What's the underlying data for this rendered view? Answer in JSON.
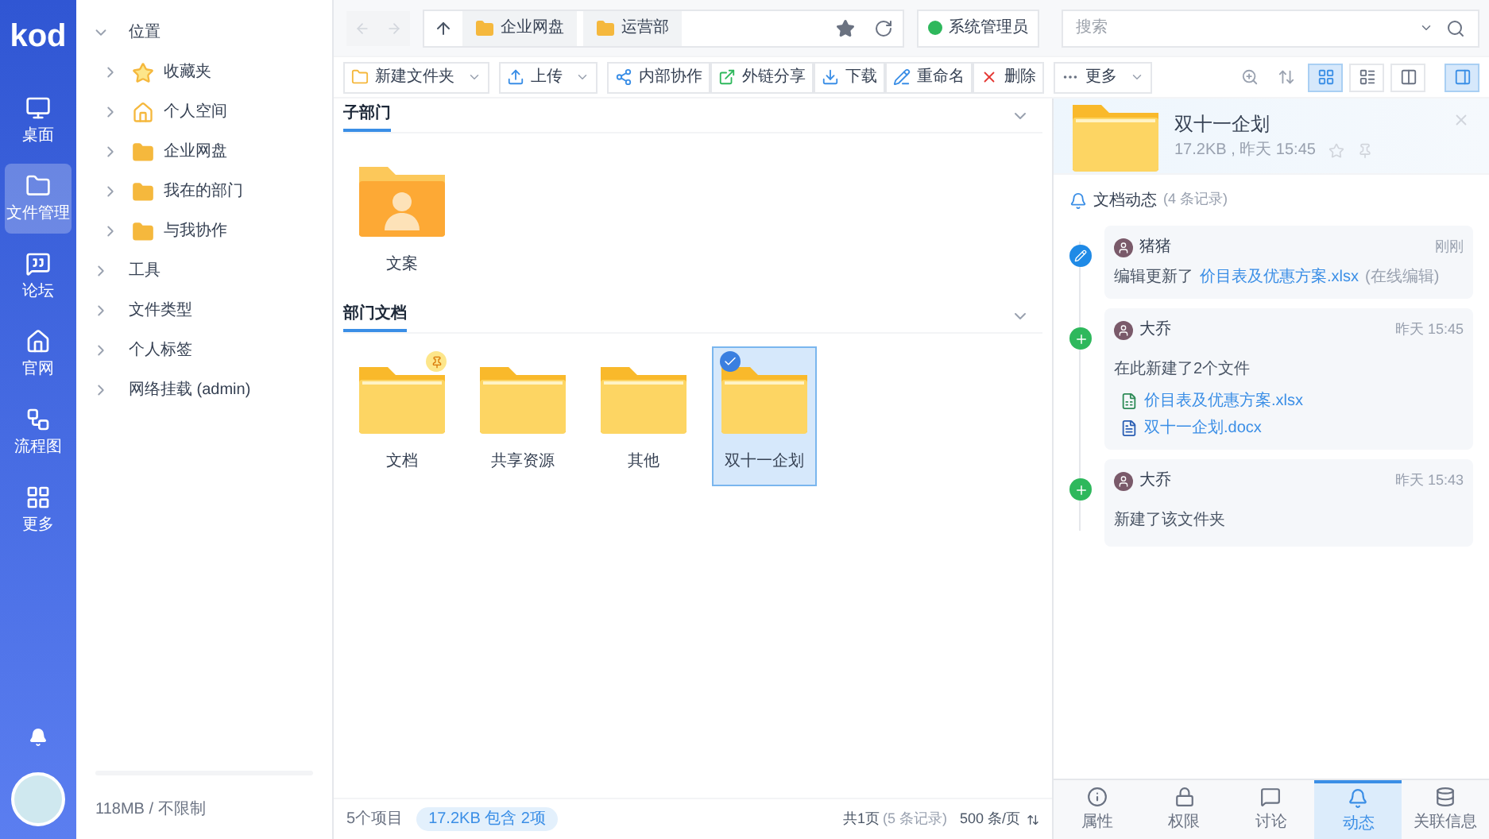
{
  "logo": "kod",
  "nav": [
    {
      "label": "桌面",
      "selected": false
    },
    {
      "label": "文件管理",
      "selected": true
    },
    {
      "label": "论坛",
      "selected": false
    },
    {
      "label": "官网",
      "selected": false
    },
    {
      "label": "流程图",
      "selected": false
    },
    {
      "label": "更多",
      "selected": false
    }
  ],
  "tree": [
    {
      "label": "位置",
      "expanded": true,
      "children": [
        {
          "label": "收藏夹",
          "expanded": false
        },
        {
          "label": "个人空间",
          "expanded": false
        },
        {
          "label": "企业网盘",
          "expanded": false
        },
        {
          "label": "我在的部门",
          "expanded": false
        },
        {
          "label": "与我协作",
          "expanded": false
        }
      ]
    },
    {
      "label": "工具",
      "expanded": false
    },
    {
      "label": "文件类型",
      "expanded": false
    },
    {
      "label": "个人标签",
      "expanded": false
    },
    {
      "label": "网络挂载 (admin)",
      "expanded": false
    }
  ],
  "storage": {
    "text": "118MB / 不限制"
  },
  "breadcrumbs": [
    "企业网盘",
    "运营部"
  ],
  "user": "系统管理员",
  "search": {
    "placeholder": "搜索"
  },
  "toolbar": [
    "新建文件夹",
    "上传",
    "内部协作",
    "外链分享",
    "下载",
    "重命名",
    "删除",
    "更多"
  ],
  "view_modes": [
    {
      "selected": true
    },
    {
      "selected": false
    },
    {
      "selected": false
    }
  ],
  "panel_toggle": {
    "selected": true
  },
  "sections": [
    {
      "title": "子部门",
      "items": [
        {
          "name": "文案",
          "kind": "dept",
          "selected": false,
          "pinned": false
        }
      ]
    },
    {
      "title": "部门文档",
      "items": [
        {
          "name": "文档",
          "kind": "folder",
          "selected": false,
          "pinned": true
        },
        {
          "name": "共享资源",
          "kind": "folder",
          "selected": false,
          "pinned": false
        },
        {
          "name": "其他",
          "kind": "folder",
          "selected": false,
          "pinned": false
        },
        {
          "name": "双十一企划",
          "kind": "folder",
          "selected": true,
          "pinned": false
        }
      ]
    }
  ],
  "status": {
    "count": "5个项目",
    "selection": "17.2KB 包含 2项",
    "pages": "共1页",
    "records": "(5 条记录)",
    "per_page": "500 条/页"
  },
  "detail": {
    "title": "双十一企划",
    "meta": "17.2KB , 昨天 15:45",
    "activity_title": "文档动态",
    "activity_count": "(4 条记录)",
    "events": [
      {
        "kind": "edit",
        "user": "猪猪",
        "time": "刚刚",
        "text": "编辑更新了",
        "files": [
          {
            "name": "价目表及优惠方案.xlsx"
          }
        ],
        "note": "(在线编辑)"
      },
      {
        "kind": "create",
        "user": "大乔",
        "time": "昨天 15:45",
        "text": "在此新建了2个文件",
        "files": [
          {
            "name": "价目表及优惠方案.xlsx",
            "kind": "sheet"
          },
          {
            "name": "双十一企划.docx",
            "kind": "doc"
          }
        ]
      },
      {
        "kind": "create",
        "user": "大乔",
        "time": "昨天 15:43",
        "text": "新建了该文件夹"
      }
    ]
  },
  "tabs": [
    {
      "label": "属性",
      "selected": false
    },
    {
      "label": "权限",
      "selected": false
    },
    {
      "label": "讨论",
      "selected": false
    },
    {
      "label": "动态",
      "selected": true
    },
    {
      "label": "关联信息",
      "selected": false
    }
  ]
}
